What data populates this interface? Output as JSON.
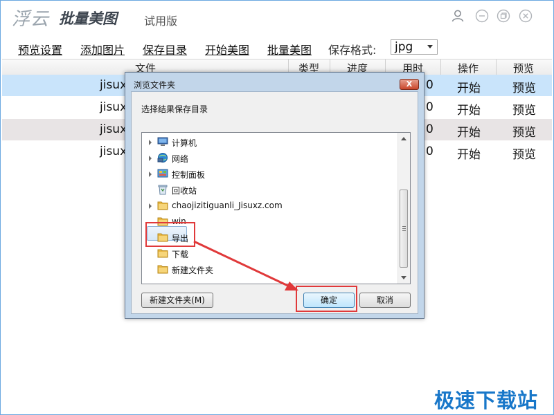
{
  "app": {
    "logo_prefix": "浮云",
    "logo_name": "批量美图",
    "edition": "试用版",
    "window_icons": [
      "user-icon",
      "minimize-icon",
      "maximize-icon",
      "close-icon"
    ]
  },
  "toolbar": {
    "preview_settings": "预览设置",
    "add_images": "添加图片",
    "save_dir": "保存目录",
    "start_beautify": "开始美图",
    "batch_beautify": "批量美图",
    "format_label": "保存格式:",
    "format_value": "jpg"
  },
  "table": {
    "headers": [
      "文件",
      "类型",
      "进度",
      "用时",
      "操作",
      "预览"
    ],
    "rows": [
      {
        "file": "jisux",
        "time": "0",
        "action": "开始",
        "preview": "预览"
      },
      {
        "file": "jisux",
        "time": "0",
        "action": "开始",
        "preview": "预览"
      },
      {
        "file": "jisux",
        "time": "0",
        "action": "开始",
        "preview": "预览"
      },
      {
        "file": "jisux",
        "time": "0",
        "action": "开始",
        "preview": "预览"
      }
    ],
    "row_colors": [
      "#c9e4fb",
      "#ffffff",
      "#e8e4e5",
      "#ffffff"
    ]
  },
  "dialog": {
    "title": "浏览文件夹",
    "close_label": "X",
    "description": "选择结果保存目录",
    "tree": [
      {
        "label": "计算机",
        "icon": "computer-icon",
        "expandable": true
      },
      {
        "label": "网络",
        "icon": "network-icon",
        "expandable": true
      },
      {
        "label": "控制面板",
        "icon": "control-panel-icon",
        "expandable": true
      },
      {
        "label": "回收站",
        "icon": "recycle-bin-icon",
        "expandable": false
      },
      {
        "label": "chaojizitiguanli_Jisuxz.com",
        "icon": "folder-icon",
        "expandable": true
      },
      {
        "label": "win",
        "icon": "folder-icon",
        "expandable": false
      },
      {
        "label": "导出",
        "icon": "folder-icon",
        "expandable": false,
        "selected": true
      },
      {
        "label": "下载",
        "icon": "folder-icon",
        "expandable": false
      },
      {
        "label": "新建文件夹",
        "icon": "folder-icon",
        "expandable": false
      }
    ],
    "new_folder_button": "新建文件夹(M)",
    "ok_button": "确定",
    "cancel_button": "取消"
  },
  "watermark": "极速下载站",
  "colors": {
    "annotation": "#e0393a",
    "selected_row": "#c9e4fb",
    "folder": "#e8b845",
    "watermark": "#1877c9"
  }
}
